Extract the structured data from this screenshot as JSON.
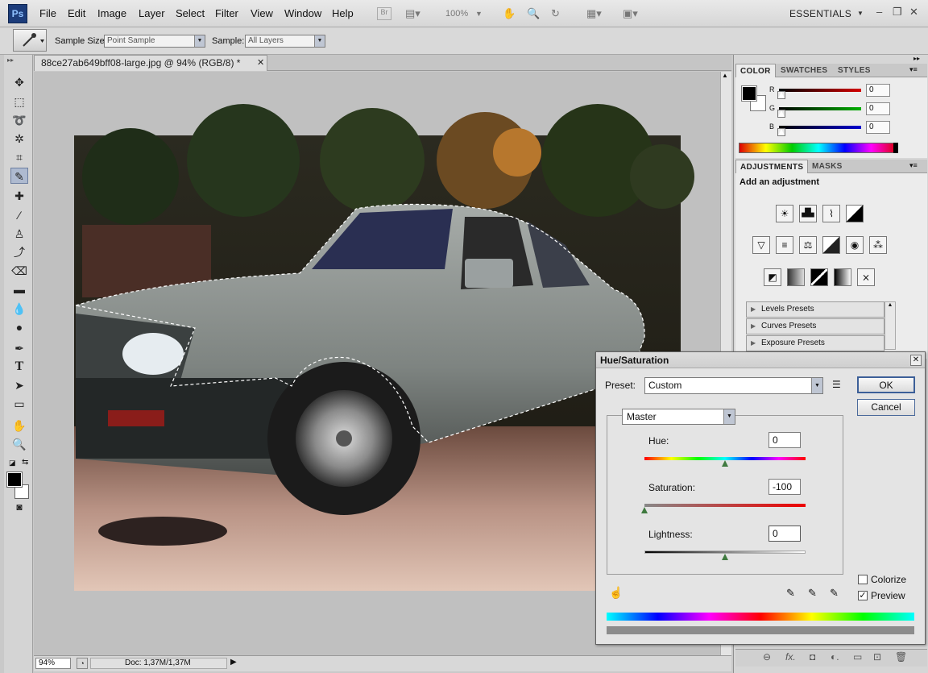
{
  "app": {
    "logo": "Ps",
    "workspace": "ESSENTIALS",
    "zoom_display": "100%"
  },
  "menu": [
    "File",
    "Edit",
    "Image",
    "Layer",
    "Select",
    "Filter",
    "View",
    "Window",
    "Help"
  ],
  "options_bar": {
    "sample_size_label": "Sample Size:",
    "sample_size_value": "Point Sample",
    "sample_label": "Sample:",
    "sample_value": "All Layers"
  },
  "document": {
    "tab_title": "88ce27ab649bff08-large.jpg @ 94% (RGB/8) *",
    "zoom": "94%",
    "doc_info": "Doc: 1,37M/1,37M"
  },
  "color_panel": {
    "tabs": [
      "COLOR",
      "SWATCHES",
      "STYLES"
    ],
    "channels": [
      {
        "label": "R",
        "value": "0",
        "color": "#d40000"
      },
      {
        "label": "G",
        "value": "0",
        "color": "#00a000"
      },
      {
        "label": "B",
        "value": "0",
        "color": "#0000c8"
      }
    ]
  },
  "adjustments_panel": {
    "tabs": [
      "ADJUSTMENTS",
      "MASKS"
    ],
    "heading": "Add an adjustment",
    "presets": [
      "Levels Presets",
      "Curves Presets",
      "Exposure Presets"
    ]
  },
  "hue_saturation": {
    "title": "Hue/Saturation",
    "preset_label": "Preset:",
    "preset_value": "Custom",
    "channel": "Master",
    "hue_label": "Hue:",
    "hue_value": "0",
    "saturation_label": "Saturation:",
    "saturation_value": "-100",
    "lightness_label": "Lightness:",
    "lightness_value": "0",
    "ok_label": "OK",
    "cancel_label": "Cancel",
    "colorize_label": "Colorize",
    "colorize_checked": false,
    "preview_label": "Preview",
    "preview_checked": true
  }
}
